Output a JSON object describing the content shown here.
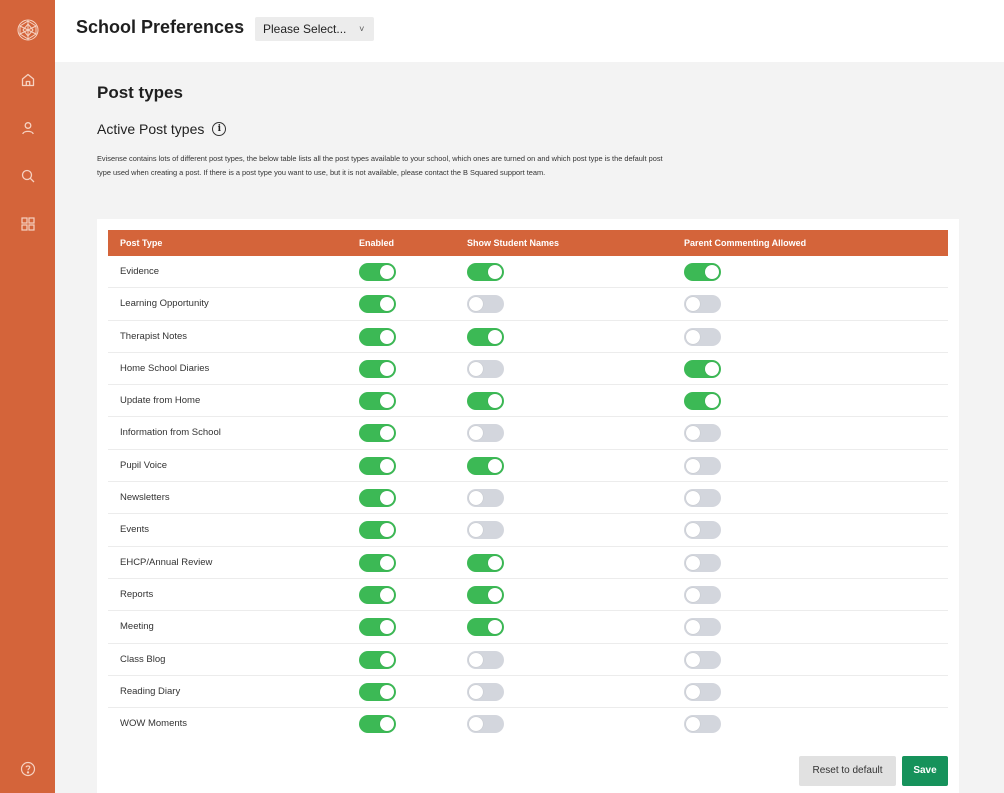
{
  "colors": {
    "brand": "#d4643a",
    "toggle_on": "#3cb955",
    "toggle_off": "#d3d6dd",
    "save": "#16925b"
  },
  "sidebar": {
    "logo": "logo-icon",
    "items": [
      {
        "icon": "home-icon"
      },
      {
        "icon": "user-icon"
      },
      {
        "icon": "search-icon"
      },
      {
        "icon": "grid-icon"
      }
    ],
    "help_icon": "help-icon"
  },
  "header": {
    "title": "School Preferences",
    "separator": "›",
    "select_value": "Please Select...",
    "select_chevron": "˅"
  },
  "page": {
    "title": "Post types",
    "section_title": "Active Post types",
    "info_glyph": "i",
    "description": "Evisense contains lots of different post types, the below table lists all the post types available to your school, which ones are turned on and which post type is the default post type used when creating a post. If there is a post type you want to use, but it is not available, please contact the B Squared support team."
  },
  "table": {
    "headers": [
      "Post Type",
      "Enabled",
      "Show Student Names",
      "Parent Commenting Allowed"
    ],
    "rows": [
      {
        "name": "Evidence",
        "enabled": true,
        "show_names": true,
        "parent_comment": true
      },
      {
        "name": "Learning Opportunity",
        "enabled": true,
        "show_names": false,
        "parent_comment": false
      },
      {
        "name": "Therapist Notes",
        "enabled": true,
        "show_names": true,
        "parent_comment": false
      },
      {
        "name": "Home School Diaries",
        "enabled": true,
        "show_names": false,
        "parent_comment": true
      },
      {
        "name": "Update from Home",
        "enabled": true,
        "show_names": true,
        "parent_comment": true
      },
      {
        "name": "Information from School",
        "enabled": true,
        "show_names": false,
        "parent_comment": false
      },
      {
        "name": "Pupil Voice",
        "enabled": true,
        "show_names": true,
        "parent_comment": false
      },
      {
        "name": "Newsletters",
        "enabled": true,
        "show_names": false,
        "parent_comment": false
      },
      {
        "name": "Events",
        "enabled": true,
        "show_names": false,
        "parent_comment": false
      },
      {
        "name": "EHCP/Annual Review",
        "enabled": true,
        "show_names": true,
        "parent_comment": false
      },
      {
        "name": "Reports",
        "enabled": true,
        "show_names": true,
        "parent_comment": false
      },
      {
        "name": "Meeting",
        "enabled": true,
        "show_names": true,
        "parent_comment": false
      },
      {
        "name": "Class Blog",
        "enabled": true,
        "show_names": false,
        "parent_comment": false
      },
      {
        "name": "Reading Diary",
        "enabled": true,
        "show_names": false,
        "parent_comment": false
      },
      {
        "name": "WOW Moments",
        "enabled": true,
        "show_names": false,
        "parent_comment": false
      }
    ]
  },
  "actions": {
    "reset_label": "Reset to default",
    "save_label": "Save"
  }
}
